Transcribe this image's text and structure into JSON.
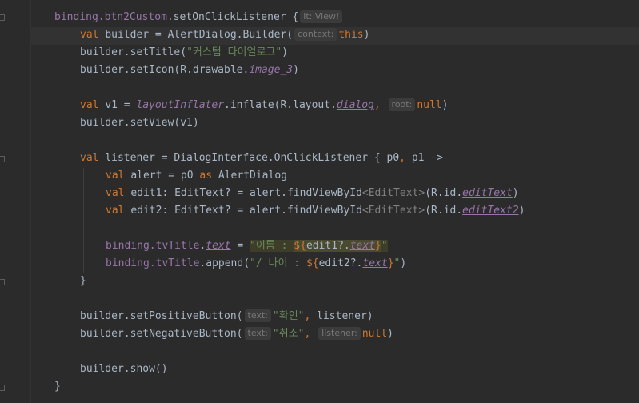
{
  "editor": {
    "lines": [
      {
        "id": "l1",
        "indent": 0,
        "tokens": [
          {
            "t": "binding.",
            "c": "prop"
          },
          {
            "t": "btn2Custom",
            "c": "prop"
          },
          {
            "t": ".setOnClickListener ",
            "c": "plain"
          },
          {
            "t": "{",
            "c": "plain"
          },
          {
            "hint": "it: View!"
          }
        ]
      },
      {
        "id": "l2",
        "indent": 1,
        "tokens": [
          {
            "t": "val ",
            "c": "kw"
          },
          {
            "t": "builder = AlertDialog.Builder(",
            "c": "plain"
          },
          {
            "hint": "context:"
          },
          {
            "t": "this",
            "c": "kw"
          },
          {
            "t": ")",
            "c": "plain"
          }
        ]
      },
      {
        "id": "l3",
        "indent": 1,
        "tokens": [
          {
            "t": "builder.setTitle(",
            "c": "plain"
          },
          {
            "t": "\"커스텀 다이얼로그\"",
            "c": "str"
          },
          {
            "t": ")",
            "c": "plain"
          }
        ]
      },
      {
        "id": "l4",
        "indent": 1,
        "tokens": [
          {
            "t": "builder.setIcon(R.drawable.",
            "c": "plain"
          },
          {
            "t": "image_3",
            "c": "prop it ul"
          },
          {
            "t": ")",
            "c": "plain"
          }
        ]
      },
      {
        "id": "l5",
        "indent": 1,
        "tokens": []
      },
      {
        "id": "l6",
        "indent": 1,
        "tokens": [
          {
            "t": "val ",
            "c": "kw"
          },
          {
            "t": "v1 = ",
            "c": "plain"
          },
          {
            "t": "layoutInflater",
            "c": "prop it"
          },
          {
            "t": ".inflate(R.layout.",
            "c": "plain"
          },
          {
            "t": "dialog",
            "c": "prop it ul"
          },
          {
            "t": ", ",
            "c": "kw"
          },
          {
            "hint": "root:"
          },
          {
            "t": "null",
            "c": "kw"
          },
          {
            "t": ")",
            "c": "plain"
          }
        ]
      },
      {
        "id": "l7",
        "indent": 1,
        "tokens": [
          {
            "t": "builder.setView(v1)",
            "c": "plain"
          }
        ]
      },
      {
        "id": "l8",
        "indent": 1,
        "tokens": []
      },
      {
        "id": "l9",
        "indent": 1,
        "tokens": [
          {
            "t": "val ",
            "c": "kw"
          },
          {
            "t": "listener = DialogInterface.OnClickListener { p0",
            "c": "plain"
          },
          {
            "t": ", ",
            "c": "kw"
          },
          {
            "t": "p1",
            "c": "plain ul"
          },
          {
            "t": " ->",
            "c": "plain"
          }
        ]
      },
      {
        "id": "l10",
        "indent": 2,
        "tokens": [
          {
            "t": "val ",
            "c": "kw"
          },
          {
            "t": "alert = p0 ",
            "c": "plain"
          },
          {
            "t": "as ",
            "c": "kw"
          },
          {
            "t": "AlertDialog",
            "c": "plain"
          }
        ]
      },
      {
        "id": "l11",
        "indent": 2,
        "tokens": [
          {
            "t": "val ",
            "c": "kw"
          },
          {
            "t": "edit1: EditText? = alert.findViewById",
            "c": "plain"
          },
          {
            "t": "<EditText>",
            "c": "gray"
          },
          {
            "t": "(R.id.",
            "c": "plain"
          },
          {
            "t": "editText",
            "c": "prop it ul"
          },
          {
            "t": ")",
            "c": "plain"
          }
        ]
      },
      {
        "id": "l12",
        "indent": 2,
        "tokens": [
          {
            "t": "val ",
            "c": "kw"
          },
          {
            "t": "edit2: EditText? = alert.findViewById",
            "c": "plain"
          },
          {
            "t": "<EditText>",
            "c": "gray"
          },
          {
            "t": "(R.id.",
            "c": "plain"
          },
          {
            "t": "editText2",
            "c": "prop it ul"
          },
          {
            "t": ")",
            "c": "plain"
          }
        ]
      },
      {
        "id": "l13",
        "indent": 2,
        "tokens": []
      },
      {
        "id": "l14",
        "indent": 2,
        "tokens": [
          {
            "t": "binding.",
            "c": "prop"
          },
          {
            "t": "tvTitle",
            "c": "prop"
          },
          {
            "t": ".",
            "c": "plain"
          },
          {
            "t": "text",
            "c": "prop it ul"
          },
          {
            "t": " = ",
            "c": "plain"
          },
          {
            "t": "\"이름 : ",
            "c": "str tmpl-hl"
          },
          {
            "t": "${",
            "c": "kw tmpl-bg"
          },
          {
            "t": "edit1?.",
            "c": "plain tmpl-bg"
          },
          {
            "t": "text",
            "c": "prop it ul tmpl-bg"
          },
          {
            "t": "}",
            "c": "kw tmpl-bg"
          },
          {
            "t": "\"",
            "c": "str tmpl-hl"
          }
        ]
      },
      {
        "id": "l15",
        "indent": 2,
        "tokens": [
          {
            "t": "binding.",
            "c": "prop"
          },
          {
            "t": "tvTitle",
            "c": "prop"
          },
          {
            "t": ".append(",
            "c": "plain"
          },
          {
            "t": "\"/ 나이 : ",
            "c": "str"
          },
          {
            "t": "${",
            "c": "kw"
          },
          {
            "t": "edit2?.",
            "c": "plain"
          },
          {
            "t": "text",
            "c": "prop it ul"
          },
          {
            "t": "}",
            "c": "kw"
          },
          {
            "t": "\"",
            "c": "str"
          },
          {
            "t": ")",
            "c": "plain"
          }
        ]
      },
      {
        "id": "l16",
        "indent": 1,
        "tokens": [
          {
            "t": "}",
            "c": "plain"
          }
        ]
      },
      {
        "id": "l17",
        "indent": 1,
        "tokens": []
      },
      {
        "id": "l18",
        "indent": 1,
        "tokens": [
          {
            "t": "builder.setPositiveButton(",
            "c": "plain"
          },
          {
            "hint": "text:"
          },
          {
            "t": "\"확인\"",
            "c": "str"
          },
          {
            "t": ", ",
            "c": "kw"
          },
          {
            "t": "listener)",
            "c": "plain"
          }
        ]
      },
      {
        "id": "l19",
        "indent": 1,
        "tokens": [
          {
            "t": "builder.setNegativeButton(",
            "c": "plain"
          },
          {
            "hint": "text:"
          },
          {
            "t": "\"취소\"",
            "c": "str"
          },
          {
            "t": ", ",
            "c": "kw"
          },
          {
            "hint": "listener:"
          },
          {
            "t": "null",
            "c": "kw"
          },
          {
            "t": ")",
            "c": "plain"
          }
        ]
      },
      {
        "id": "l20",
        "indent": 1,
        "tokens": []
      },
      {
        "id": "l21",
        "indent": 1,
        "tokens": [
          {
            "t": "builder.show()",
            "c": "plain"
          }
        ]
      },
      {
        "id": "l22",
        "indent": 0,
        "tokens": [
          {
            "t": "}",
            "c": "plain"
          }
        ]
      }
    ]
  },
  "colors": {
    "background": "#2b2b2b",
    "keyword": "#cc7832",
    "property": "#9876aa",
    "string": "#6a8759",
    "text": "#a9b7c6",
    "hint_text": "#787878",
    "hint_bg": "#3b3b3b"
  }
}
